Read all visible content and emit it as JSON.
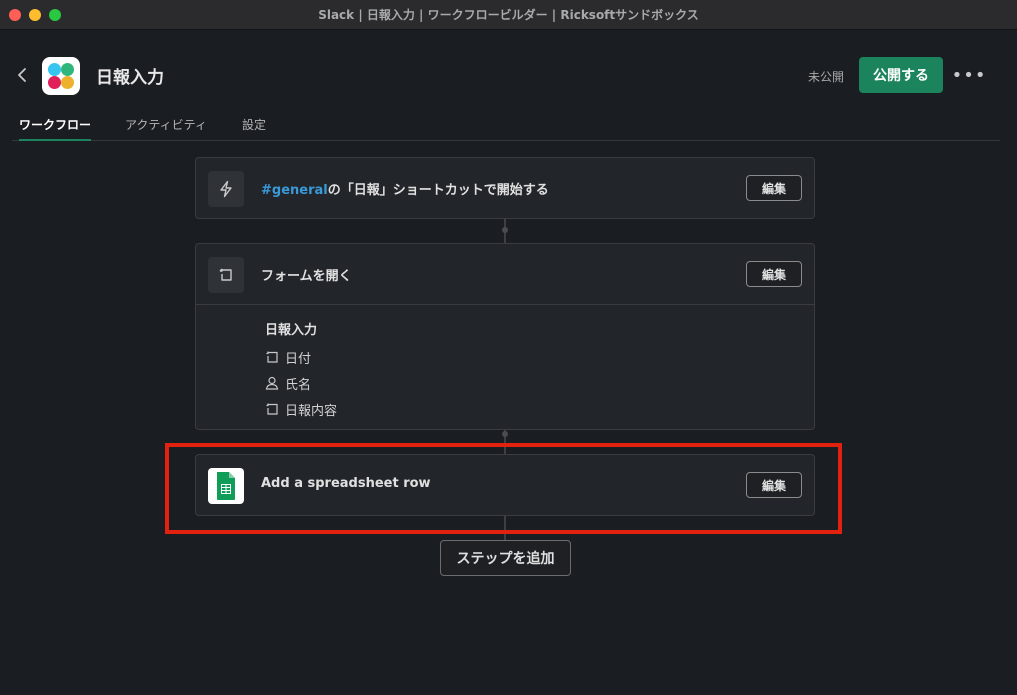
{
  "window": {
    "title": "Slack | 日報入力 | ワークフロービルダー | Ricksoftサンドボックス"
  },
  "header": {
    "back_icon": "chevron-left-icon",
    "app_icon": "workflow-app-icon",
    "title": "日報入力",
    "status": "未公開",
    "publish_label": "公開する",
    "more_icon": "more-horizontal-icon",
    "more_glyph": "•••"
  },
  "tabs": [
    {
      "label": "ワークフロー",
      "active": true
    },
    {
      "label": "アクティビティ",
      "active": false
    },
    {
      "label": "設定",
      "active": false
    }
  ],
  "steps": [
    {
      "icon": "lightning-icon",
      "channel": "#general",
      "title_suffix": "の「日報」ショートカットで開始する",
      "edit_label": "編集"
    },
    {
      "icon": "form-icon",
      "title": "フォームを開く",
      "edit_label": "編集",
      "form": {
        "name": "日報入力",
        "fields": [
          {
            "icon": "text-field-icon",
            "label": "日付"
          },
          {
            "icon": "person-icon",
            "label": "氏名"
          },
          {
            "icon": "text-field-icon",
            "label": "日報内容"
          }
        ]
      }
    },
    {
      "icon": "google-sheets-icon",
      "title": "Add a spreadsheet row",
      "edit_label": "編集",
      "highlighted": true
    }
  ],
  "add_step_label": "ステップを追加",
  "colors": {
    "background": "#1a1d21",
    "publish_button": "#1b845c",
    "hashtag": "#3a9ad9",
    "highlight": "#e2220f",
    "sheets_green": "#0f9d58"
  }
}
